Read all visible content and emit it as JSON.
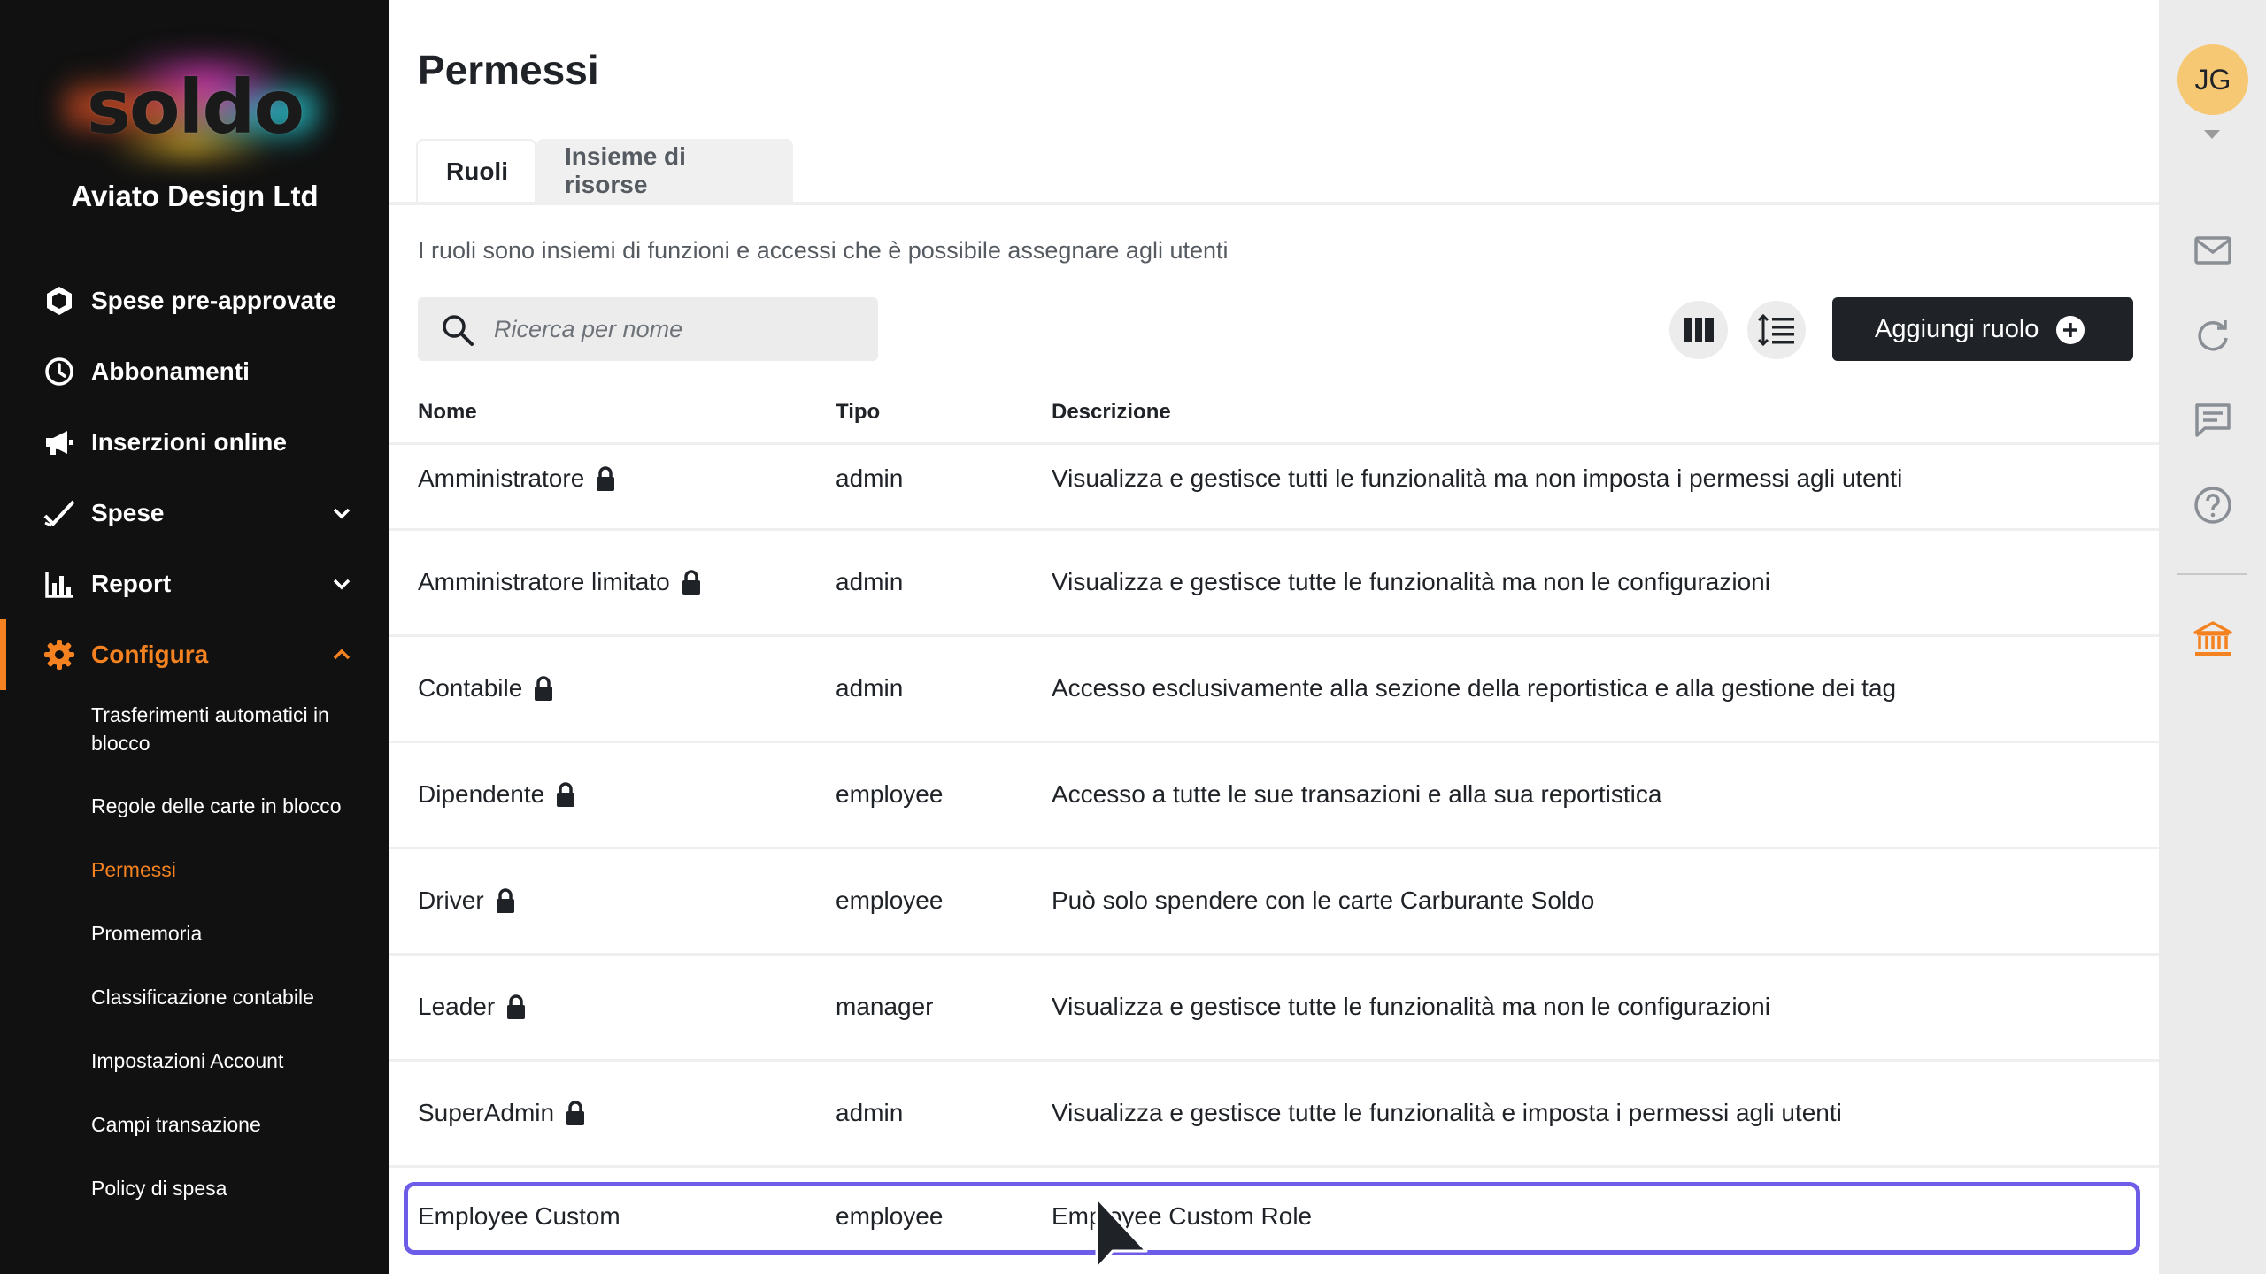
{
  "brand": {
    "logo_text": "soldo",
    "company": "Aviato Design Ltd",
    "accent_color": "#f58220"
  },
  "sidebar": {
    "items": [
      {
        "label": "Spese pre-approvate",
        "icon": "hexagon-icon"
      },
      {
        "label": "Abbonamenti",
        "icon": "clock-icon"
      },
      {
        "label": "Inserzioni online",
        "icon": "megaphone-icon"
      },
      {
        "label": "Spese",
        "icon": "check-icon",
        "expandable": true
      },
      {
        "label": "Report",
        "icon": "bar-chart-icon",
        "expandable": true
      },
      {
        "label": "Configura",
        "icon": "gear-icon",
        "expandable": true,
        "expanded": true,
        "active": true
      }
    ],
    "subitems": [
      {
        "label": "Trasferimenti automatici in blocco"
      },
      {
        "label": "Regole delle carte in blocco"
      },
      {
        "label": "Permessi",
        "active": true
      },
      {
        "label": "Promemoria"
      },
      {
        "label": "Classificazione contabile"
      },
      {
        "label": "Impostazioni Account"
      },
      {
        "label": "Campi transazione"
      },
      {
        "label": "Policy di spesa"
      }
    ]
  },
  "main": {
    "title": "Permessi",
    "tabs": [
      {
        "label": "Ruoli",
        "active": true
      },
      {
        "label": "Insieme di risorse"
      }
    ],
    "intro": "I ruoli sono insiemi di funzioni e accessi che è possibile assegnare agli utenti",
    "search": {
      "placeholder": "Ricerca per nome",
      "value": ""
    },
    "add_button": "Aggiungi ruolo",
    "table": {
      "headers": {
        "name": "Nome",
        "type": "Tipo",
        "description": "Descrizione"
      },
      "rows": [
        {
          "name": "Amministratore",
          "locked": true,
          "type": "admin",
          "description": "Visualizza e gestisce tutti le funzionalità ma non imposta i permessi agli utenti"
        },
        {
          "name": "Amministratore limitato",
          "locked": true,
          "type": "admin",
          "description": "Visualizza e gestisce tutte le funzionalità ma non le configurazioni"
        },
        {
          "name": "Contabile",
          "locked": true,
          "type": "admin",
          "description": "Accesso esclusivamente alla sezione della reportistica e alla gestione dei tag"
        },
        {
          "name": "Dipendente",
          "locked": true,
          "type": "employee",
          "description": "Accesso a tutte le sue transazioni e alla sua reportistica"
        },
        {
          "name": "Driver",
          "locked": true,
          "type": "employee",
          "description": "Può solo spendere con le carte Carburante Soldo"
        },
        {
          "name": "Leader",
          "locked": true,
          "type": "manager",
          "description": "Visualizza e gestisce tutte le funzionalità ma non le configurazioni"
        },
        {
          "name": "SuperAdmin",
          "locked": true,
          "type": "admin",
          "description": "Visualizza e gestisce tutte le funzionalità e imposta i permessi agli utenti"
        },
        {
          "name": "Employee Custom",
          "locked": false,
          "type": "employee",
          "description": "Employee Custom Role",
          "highlighted": true
        }
      ]
    }
  },
  "rail": {
    "avatar_initials": "JG",
    "icons": [
      "mail-icon",
      "refresh-icon",
      "chat-icon",
      "help-icon",
      "bank-icon"
    ],
    "highlight_color": "#6c5ce7"
  }
}
